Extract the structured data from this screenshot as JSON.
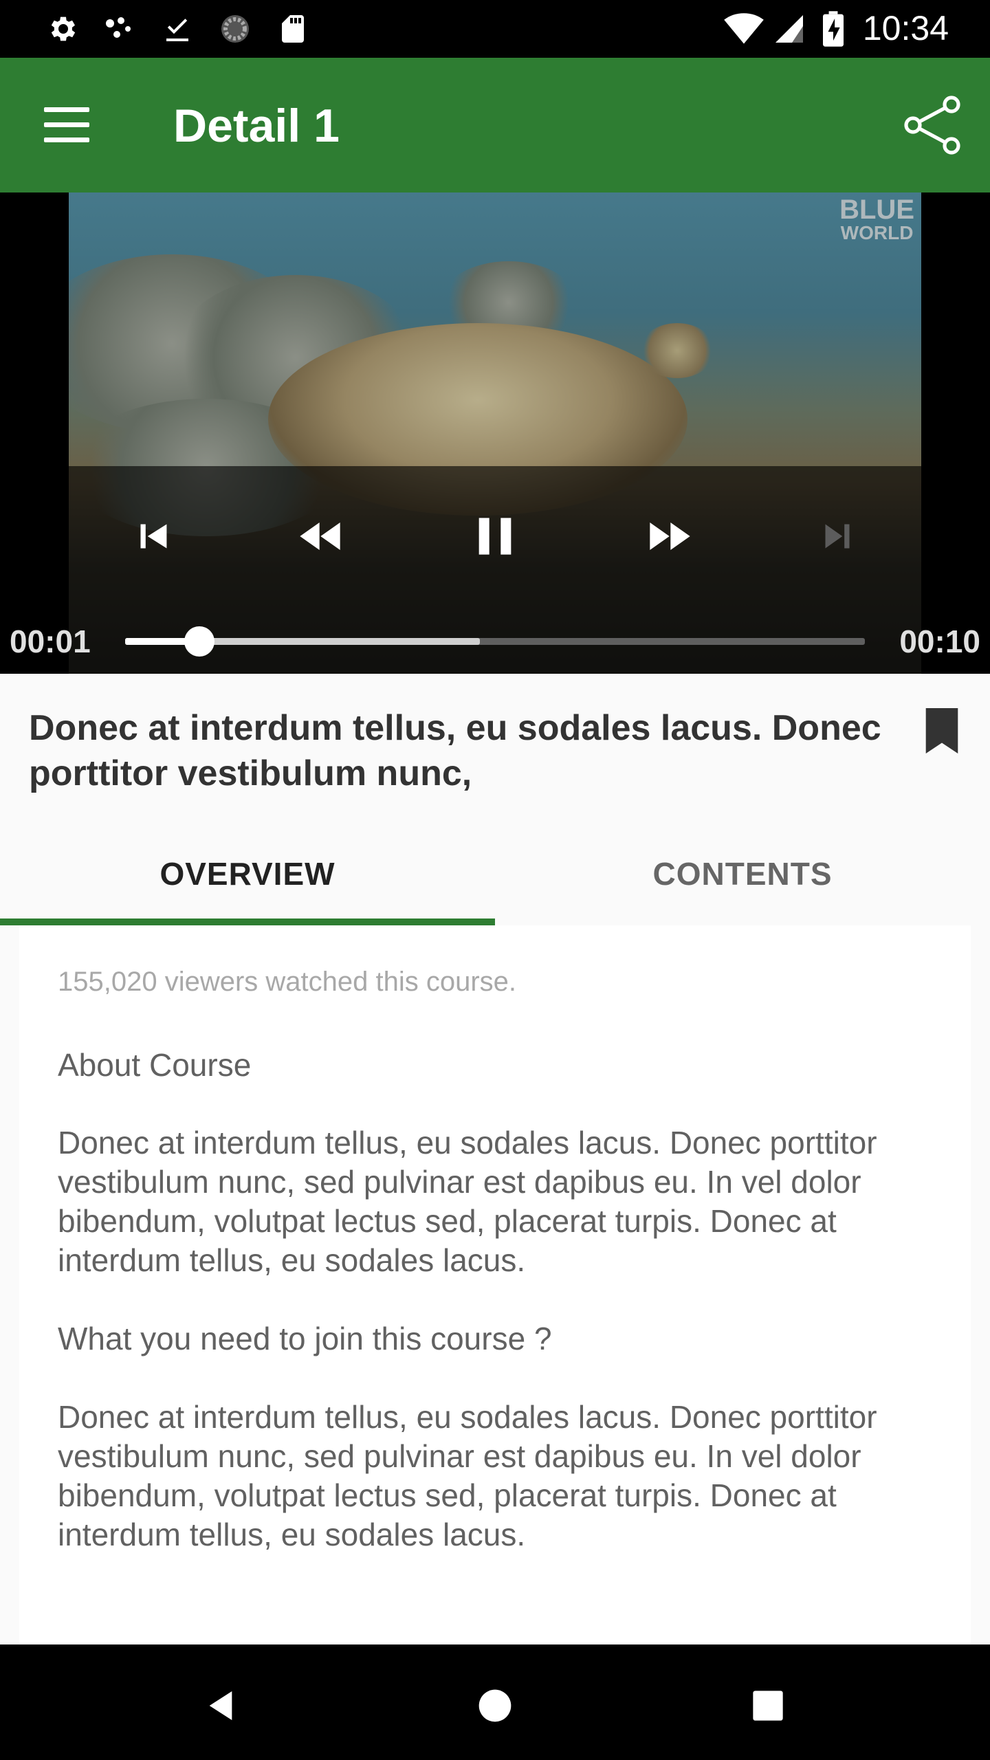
{
  "status_bar": {
    "time": "10:34",
    "icons": [
      "settings-icon",
      "cast-dots-icon",
      "download-done-icon",
      "loading-circle-icon",
      "sd-card-icon",
      "wifi-icon",
      "signal-icon",
      "battery-charging-icon"
    ]
  },
  "app_bar": {
    "title": "Detail 1",
    "menu_icon": "hamburger-menu-icon",
    "share_icon": "share-icon",
    "color": "#2e7d32"
  },
  "video": {
    "watermark_line1": "BLUE",
    "watermark_line2": "WORLD",
    "current_time": "00:01",
    "duration": "00:10",
    "played_fraction": 0.1,
    "buffered_fraction": 0.48,
    "controls": [
      "skip-previous-icon",
      "rewind-icon",
      "pause-icon",
      "fast-forward-icon",
      "skip-next-icon"
    ]
  },
  "course": {
    "title": "Donec at interdum tellus, eu sodales lacus. Donec porttitor vestibulum nunc,",
    "bookmark_icon": "bookmark-icon"
  },
  "tabs": {
    "items": [
      {
        "label": "OVERVIEW",
        "active": true
      },
      {
        "label": "CONTENTS",
        "active": false
      }
    ]
  },
  "overview": {
    "viewers": "155,020 viewers watched this course.",
    "about_heading": "About Course",
    "about_text": "Donec at interdum tellus, eu sodales lacus. Donec porttitor vestibulum nunc, sed pulvinar est dapibus eu. In vel dolor bibendum, volutpat lectus sed, placerat turpis. Donec at interdum tellus, eu sodales lacus.",
    "requirements_heading": "What you need to join this course ?",
    "requirements_text": "Donec at interdum tellus, eu sodales lacus. Donec porttitor vestibulum nunc, sed pulvinar est dapibus eu. In vel dolor bibendum, volutpat lectus sed, placerat turpis. Donec at interdum tellus, eu sodales lacus."
  },
  "nav_bar": {
    "buttons": [
      "back-icon",
      "home-icon",
      "recents-icon"
    ]
  }
}
